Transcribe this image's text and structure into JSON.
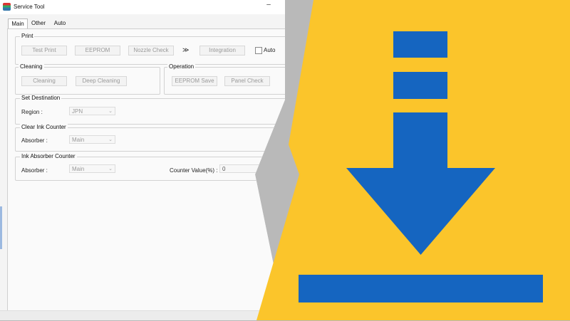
{
  "window": {
    "title": "Service Tool",
    "minimize_glyph": "–"
  },
  "tabs": [
    "Main",
    "Other",
    "Auto"
  ],
  "print_group": {
    "title": "Print",
    "buttons": [
      "Test Print",
      "EEPROM",
      "Nozzle Check",
      "Integration"
    ],
    "arrow": "≫",
    "auto_label": "Auto"
  },
  "cleaning_group": {
    "title": "Cleaning",
    "buttons": [
      "Cleaning",
      "Deep Cleaning"
    ]
  },
  "operation_group": {
    "title": "Operation",
    "buttons": [
      "EEPROM Save",
      "Panel Check"
    ]
  },
  "destination_group": {
    "title": "Set Destination",
    "label": "Region :",
    "value": "JPN"
  },
  "clear_counter_group": {
    "title": "Clear Ink Counter",
    "label": "Absorber :",
    "value": "Main"
  },
  "absorber_counter_group": {
    "title": "Ink Absorber Counter",
    "label": "Absorber :",
    "value": "Main",
    "counter_label": "Counter Value(%) :",
    "counter_value": "0"
  },
  "icons": {
    "download": "download-arrow-icon"
  },
  "colors": {
    "accent_yellow": "#fbc52b",
    "icon_blue": "#1565c0",
    "divider_grey": "#b9b9b9"
  }
}
